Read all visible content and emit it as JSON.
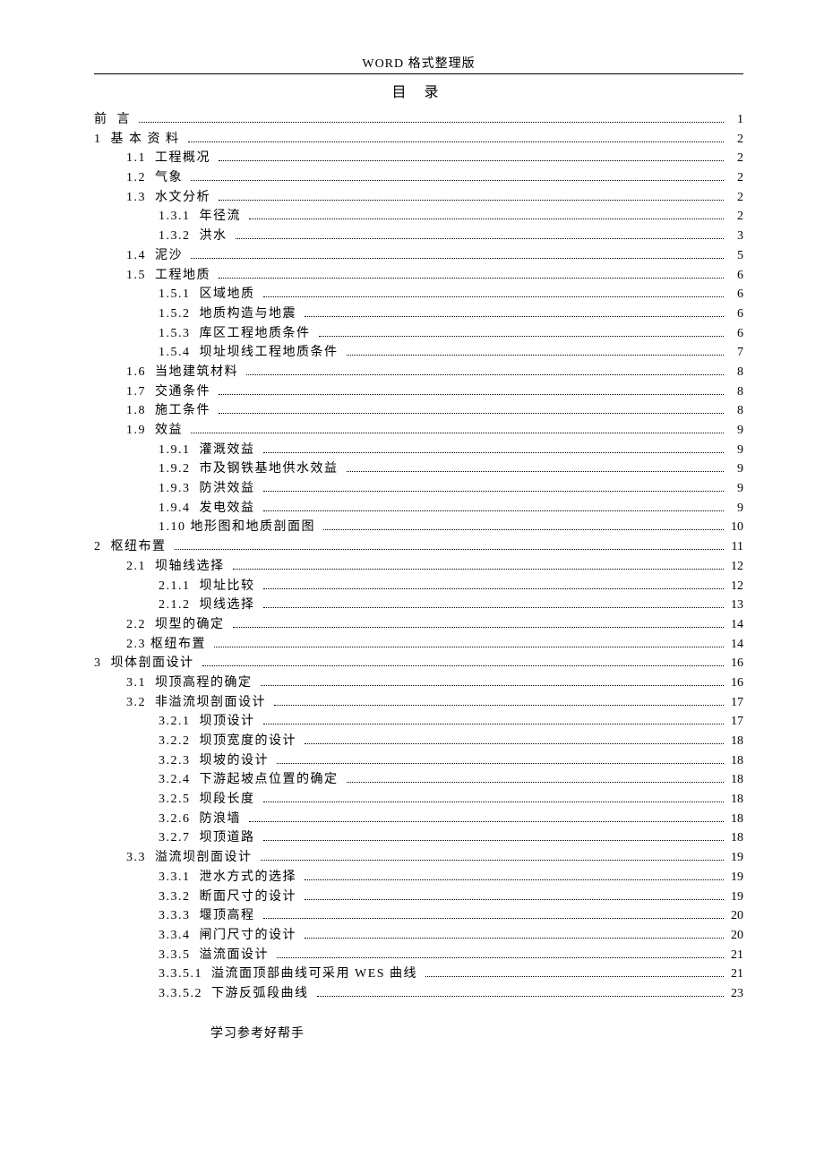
{
  "header": "WORD 格式整理版",
  "title": "目 录",
  "footer": "学习参考好帮手",
  "toc": [
    {
      "level": 0,
      "label": "前  言",
      "page": "1"
    },
    {
      "level": 0,
      "label": "1  基 本 资 料",
      "page": "2"
    },
    {
      "level": 1,
      "label": "1.1  工程概况",
      "page": "2"
    },
    {
      "level": 1,
      "label": "1.2  气象",
      "page": "2"
    },
    {
      "level": 1,
      "label": "1.3  水文分析",
      "page": "2"
    },
    {
      "level": 2,
      "label": "1.3.1  年径流",
      "page": "2"
    },
    {
      "level": 2,
      "label": "1.3.2  洪水",
      "page": "3"
    },
    {
      "level": 1,
      "label": "1.4  泥沙",
      "page": "5"
    },
    {
      "level": 1,
      "label": "1.5  工程地质",
      "page": "6"
    },
    {
      "level": 2,
      "label": "1.5.1  区域地质",
      "page": "6"
    },
    {
      "level": 2,
      "label": "1.5.2  地质构造与地震",
      "page": "6"
    },
    {
      "level": 2,
      "label": "1.5.3  库区工程地质条件",
      "page": "6"
    },
    {
      "level": 2,
      "label": "1.5.4  坝址坝线工程地质条件",
      "page": "7"
    },
    {
      "level": 1,
      "label": "1.6  当地建筑材料",
      "page": "8"
    },
    {
      "level": 1,
      "label": "1.7  交通条件",
      "page": "8"
    },
    {
      "level": 1,
      "label": "1.8  施工条件",
      "page": "8"
    },
    {
      "level": 1,
      "label": "1.9  效益",
      "page": "9"
    },
    {
      "level": 2,
      "label": "1.9.1  灌溉效益",
      "page": "9"
    },
    {
      "level": 2,
      "label": "1.9.2  市及钢铁基地供水效益",
      "page": "9"
    },
    {
      "level": 2,
      "label": "1.9.3  防洪效益",
      "page": "9"
    },
    {
      "level": 2,
      "label": "1.9.4  发电效益",
      "page": "9"
    },
    {
      "level": 2,
      "label": "1.10 地形图和地质剖面图",
      "page": "10"
    },
    {
      "level": 0,
      "label": "2  枢纽布置",
      "page": "11"
    },
    {
      "level": 1,
      "label": "2.1  坝轴线选择",
      "page": "12"
    },
    {
      "level": 2,
      "label": "2.1.1  坝址比较",
      "page": "12"
    },
    {
      "level": 2,
      "label": "2.1.2  坝线选择",
      "page": "13"
    },
    {
      "level": 1,
      "label": "2.2  坝型的确定",
      "page": "14"
    },
    {
      "level": 1,
      "label": "2.3 枢纽布置",
      "page": "14"
    },
    {
      "level": 0,
      "label": "3  坝体剖面设计",
      "page": "16"
    },
    {
      "level": 1,
      "label": "3.1  坝顶高程的确定",
      "page": "16"
    },
    {
      "level": 1,
      "label": "3.2  非溢流坝剖面设计",
      "page": "17"
    },
    {
      "level": 2,
      "label": "3.2.1  坝顶设计",
      "page": "17"
    },
    {
      "level": 2,
      "label": "3.2.2  坝顶宽度的设计",
      "page": "18"
    },
    {
      "level": 2,
      "label": "3.2.3  坝坡的设计",
      "page": "18"
    },
    {
      "level": 2,
      "label": "3.2.4  下游起坡点位置的确定",
      "page": "18"
    },
    {
      "level": 2,
      "label": "3.2.5  坝段长度",
      "page": "18"
    },
    {
      "level": 2,
      "label": "3.2.6  防浪墙",
      "page": "18"
    },
    {
      "level": 2,
      "label": "3.2.7  坝顶道路",
      "page": "18"
    },
    {
      "level": 1,
      "label": "3.3  溢流坝剖面设计",
      "page": "19"
    },
    {
      "level": 2,
      "label": "3.3.1  泄水方式的选择",
      "page": "19"
    },
    {
      "level": 2,
      "label": "3.3.2  断面尺寸的设计",
      "page": "19"
    },
    {
      "level": 2,
      "label": "3.3.3  堰顶高程",
      "page": "20"
    },
    {
      "level": 2,
      "label": "3.3.4  闸门尺寸的设计",
      "page": "20"
    },
    {
      "level": 2,
      "label": "3.3.5  溢流面设计",
      "page": "21"
    },
    {
      "level": 2,
      "label": "3.3.5.1  溢流面顶部曲线可采用 WES 曲线",
      "page": "21"
    },
    {
      "level": 2,
      "label": "3.3.5.2  下游反弧段曲线",
      "page": "23"
    }
  ]
}
